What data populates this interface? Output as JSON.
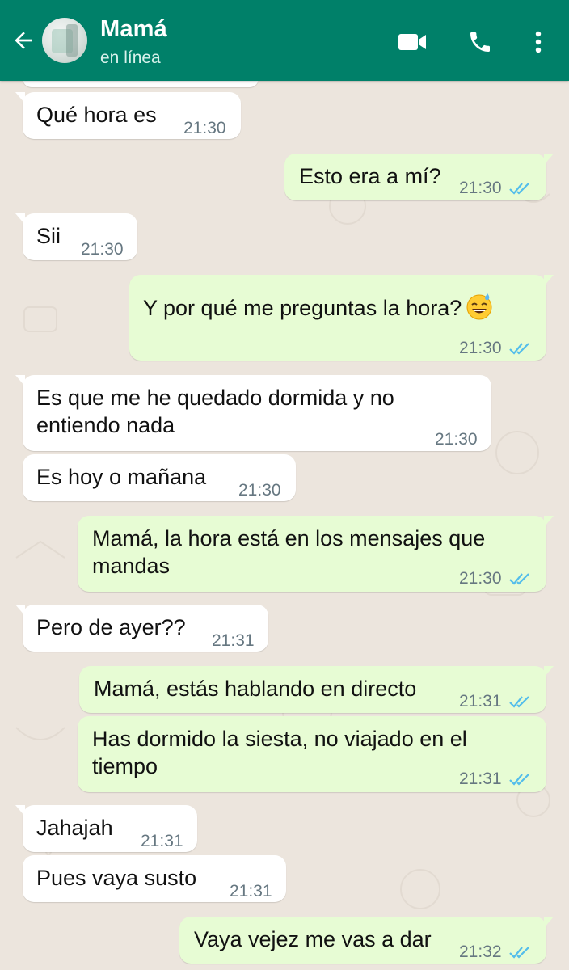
{
  "header": {
    "contact_name": "Mamá",
    "status": "en línea",
    "icons": [
      "back-arrow-icon",
      "video-call-icon",
      "phone-icon",
      "more-vertical-icon"
    ],
    "background_color": "#008069"
  },
  "colors": {
    "incoming_bubble": "#ffffff",
    "outgoing_bubble": "#e7fcd4",
    "read_ticks": "#53bdeb",
    "chat_background": "#ece5dd"
  },
  "messages": [
    {
      "dir": "in",
      "text": "Qué hora es",
      "time": "21:30"
    },
    {
      "dir": "out",
      "text": "Esto era a mí?",
      "time": "21:30",
      "read": true
    },
    {
      "dir": "in",
      "text": "Sii",
      "time": "21:30"
    },
    {
      "dir": "out",
      "text": "Y por qué me preguntas la hora?",
      "emoji": "grinning-face-with-sweat-emoji",
      "time": "21:30",
      "read": true
    },
    {
      "dir": "in",
      "text_line1": "Es que me he quedado dormida y no",
      "text_line2": "entiendo nada",
      "time": "21:30"
    },
    {
      "dir": "in",
      "text": "Es hoy o mañana",
      "time": "21:30"
    },
    {
      "dir": "out",
      "text_line1": "Mamá, la hora está en los mensajes que",
      "text_line2": "mandas",
      "time": "21:30",
      "read": true
    },
    {
      "dir": "in",
      "text": "Pero de ayer??",
      "time": "21:31"
    },
    {
      "dir": "out",
      "text": "Mamá, estás hablando en directo",
      "time": "21:31",
      "read": true
    },
    {
      "dir": "out",
      "text_line1": "Has dormido la siesta, no viajado en el",
      "text_line2": "tiempo",
      "time": "21:31",
      "read": true
    },
    {
      "dir": "in",
      "text": "Jahajah",
      "time": "21:31"
    },
    {
      "dir": "in",
      "text": "Pues vaya susto",
      "time": "21:31"
    },
    {
      "dir": "out",
      "text": "Vaya vejez me vas a dar",
      "time": "21:32",
      "read": true
    }
  ]
}
